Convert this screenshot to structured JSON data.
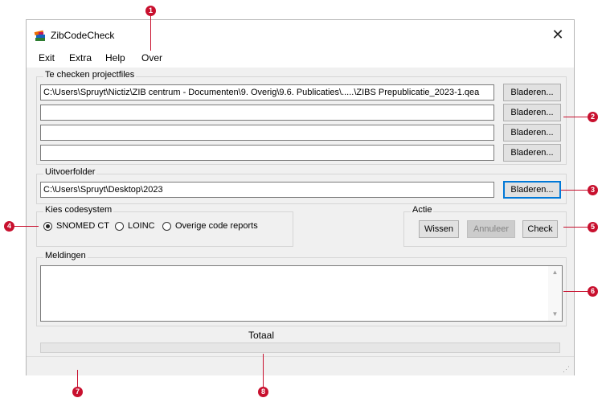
{
  "window": {
    "title": "ZibCodeCheck",
    "close_glyph": "✕",
    "app_icon": "stacked-books-icon"
  },
  "menu": [
    "Exit",
    "Extra",
    "Help",
    "Over"
  ],
  "projectfiles": {
    "label": "Te checken projectfiles",
    "paths": [
      "C:\\Users\\Spruyt\\Nictiz\\ZIB centrum - Documenten\\9. Overig\\9.6. Publicaties\\.....\\ZIBS Prepublicatie_2023-1.qea",
      "",
      "",
      ""
    ],
    "browse_label": "Bladeren..."
  },
  "output": {
    "label": "Uitvoerfolder",
    "path": "C:\\Users\\Spruyt\\Desktop\\2023",
    "browse_label": "Bladeren..."
  },
  "codesystem": {
    "label": "Kies codesystem",
    "options": [
      "SNOMED CT",
      "LOINC",
      "Overige code reports"
    ],
    "selected": "SNOMED CT"
  },
  "actie": {
    "label": "Actie",
    "clear": "Wissen",
    "cancel": "Annuleer",
    "check": "Check"
  },
  "meldingen": {
    "label": "Meldingen",
    "content": ""
  },
  "progress": {
    "label": "Totaal",
    "value": 0
  },
  "callouts": [
    "1",
    "2",
    "3",
    "4",
    "5",
    "6",
    "7",
    "8"
  ],
  "colors": {
    "callout": "#c8102e",
    "focus": "#0078d7"
  }
}
